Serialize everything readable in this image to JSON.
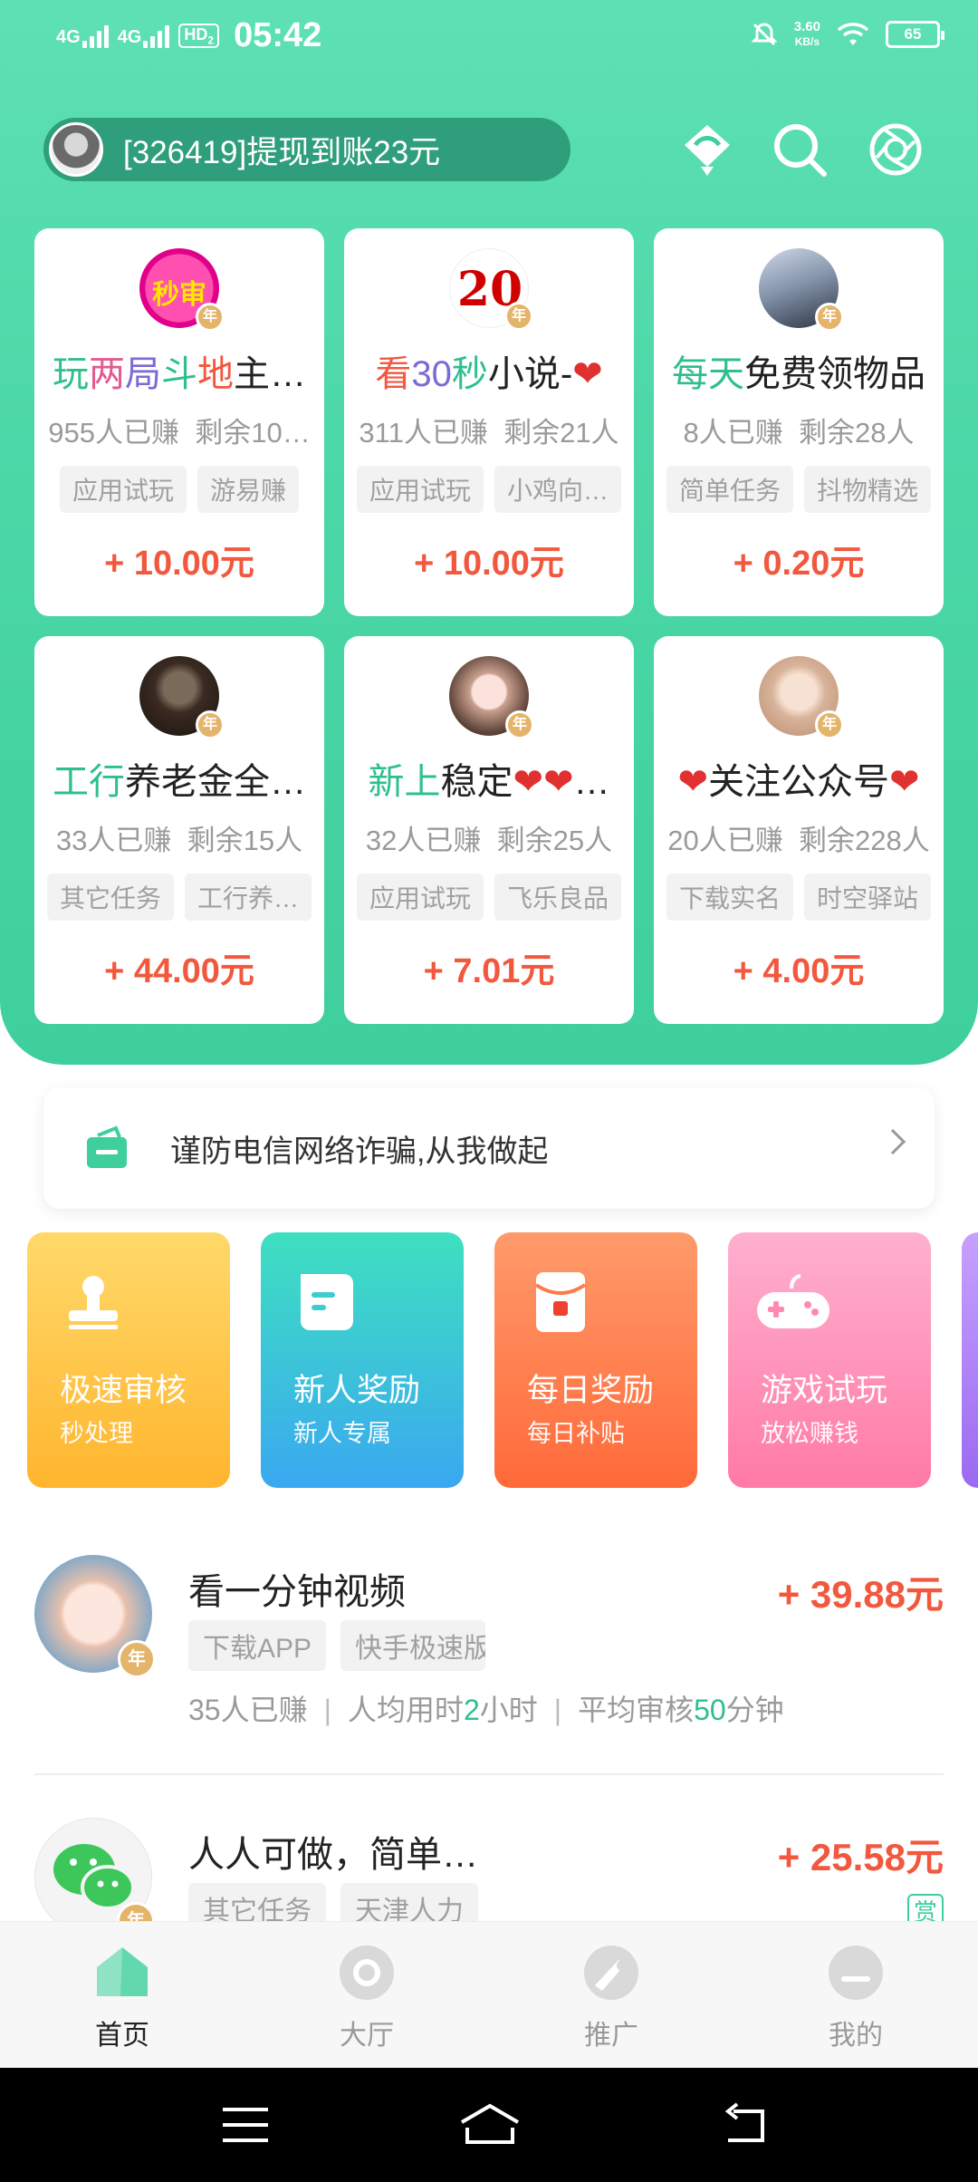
{
  "status_bar": {
    "net1": "4G",
    "net2": "4G",
    "hd": "HD",
    "hd_sub": "2",
    "time": "05:42",
    "speed_value": "3.60",
    "speed_unit": "KB/s",
    "battery": "65"
  },
  "header": {
    "ticker_text": "[326419]提现到账23元",
    "icons": [
      "gift-icon",
      "search-icon",
      "camera-shutter-icon"
    ]
  },
  "featured_cards": [
    {
      "title": "玩两局斗地主…",
      "title_colors": [
        "#2fbf8e",
        "#e25a8e",
        "#7a6bd6",
        "#2fbf8e",
        "#f2583e",
        "#222222",
        "#222222"
      ],
      "earned": "955人已赚",
      "remaining": "剩余10…",
      "tags": [
        "应用试玩",
        "游易赚"
      ],
      "reward": "+ 10.00元",
      "avatar_text": "秒审"
    },
    {
      "title": "看30秒小说-❤",
      "title_colors": [
        "#f2583e",
        "#7a6bd6",
        "#7a6bd6",
        "#2fbf8e",
        "#222222",
        "#222222",
        "#222222",
        "#e03030"
      ],
      "earned": "311人已赚",
      "remaining": "剩余21人",
      "tags": [
        "应用试玩",
        "小鸡向…"
      ],
      "reward": "+ 10.00元",
      "avatar_text": "20"
    },
    {
      "title": "每天免费领物品",
      "title_colors": [
        "#2fbf8e",
        "#2fbf8e",
        "#222222",
        "#222222",
        "#222222",
        "#222222",
        "#222222"
      ],
      "earned": "8人已赚",
      "remaining": "剩余28人",
      "tags": [
        "简单任务",
        "抖物精选"
      ],
      "reward": "+ 0.20元",
      "avatar_text": ""
    },
    {
      "title": "工行养老金全…",
      "title_colors": [
        "#2fbf8e",
        "#2fbf8e",
        "#222222",
        "#222222",
        "#222222",
        "#222222",
        "#222222"
      ],
      "earned": "33人已赚",
      "remaining": "剩余15人",
      "tags": [
        "其它任务",
        "工行养…"
      ],
      "reward": "+ 44.00元",
      "avatar_text": ""
    },
    {
      "title": "新上稳定❤❤…",
      "title_colors": [
        "#2fbf8e",
        "#2fbf8e",
        "#222222",
        "#222222",
        "#e03030",
        "#e03030",
        "#222222"
      ],
      "earned": "32人已赚",
      "remaining": "剩余25人",
      "tags": [
        "应用试玩",
        "飞乐良品"
      ],
      "reward": "+ 7.01元",
      "avatar_text": ""
    },
    {
      "title": "❤关注公众号❤",
      "title_colors": [
        "#e03030",
        "#222222",
        "#222222",
        "#222222",
        "#222222",
        "#222222",
        "#e03030"
      ],
      "earned": "20人已赚",
      "remaining": "剩余228人",
      "tags": [
        "下载实名",
        "时空驿站"
      ],
      "reward": "+ 4.00元",
      "avatar_text": ""
    }
  ],
  "badge_text": "年",
  "notice": {
    "text": "谨防电信网络诈骗,从我做起"
  },
  "categories": [
    {
      "name": "极速审核",
      "sub": "秒处理",
      "icon": "stamp-icon",
      "color_top": "#ffd96a",
      "color_bottom": "#ffb52e"
    },
    {
      "name": "新人奖励",
      "sub": "新人专属",
      "icon": "document-icon",
      "color_top": "#3ee0c0",
      "color_bottom": "#3aa8f0"
    },
    {
      "name": "每日奖励",
      "sub": "每日补贴",
      "icon": "red-envelope-icon",
      "color_top": "#ff9a6a",
      "color_bottom": "#ff6a3a"
    },
    {
      "name": "游戏试玩",
      "sub": "放松赚钱",
      "icon": "gamepad-icon",
      "color_top": "#ffb0cf",
      "color_bottom": "#ff7aa6"
    }
  ],
  "tasks": [
    {
      "title": "看一分钟视频",
      "price": "+ 39.88元",
      "tags": [
        "下载APP",
        "快手极速版"
      ],
      "earned": "35人已赚",
      "avg_time_prefix": "人均用时",
      "avg_time_value": "2",
      "avg_time_suffix": "小时",
      "review_prefix": "平均审核",
      "review_value": "50",
      "review_suffix": "分钟"
    },
    {
      "title": "人人可做，简单…",
      "price": "+ 25.58元",
      "tags": [
        "其它任务",
        "天津人力"
      ],
      "reward_badge": "赏"
    }
  ],
  "tabbar": {
    "items": [
      {
        "label": "首页",
        "icon": "home-icon",
        "active": true
      },
      {
        "label": "大厅",
        "icon": "hall-icon",
        "active": false
      },
      {
        "label": "推广",
        "icon": "promote-icon",
        "active": false
      },
      {
        "label": "我的",
        "icon": "profile-icon",
        "active": false
      }
    ]
  },
  "colors": {
    "brand_green": "#3fcf9c",
    "reward_red": "#f2583e"
  }
}
